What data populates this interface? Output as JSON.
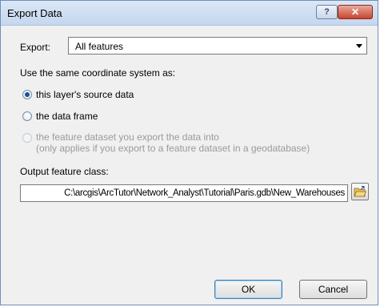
{
  "window": {
    "title": "Export Data"
  },
  "titlebar": {
    "help_label": "?",
    "close_label": "✕"
  },
  "export": {
    "label": "Export:",
    "selected": "All features"
  },
  "coordinate": {
    "label": "Use the same coordinate system as:",
    "options": [
      {
        "label": "this layer's source data",
        "checked": true,
        "enabled": true
      },
      {
        "label": "the data frame",
        "checked": false,
        "enabled": true
      },
      {
        "label": "the feature dataset you export the data into",
        "note": "(only applies if you export to a feature dataset in a geodatabase)",
        "checked": false,
        "enabled": false
      }
    ]
  },
  "output": {
    "label": "Output feature class:",
    "path": "C:\\arcgis\\ArcTutor\\Network_Analyst\\Tutorial\\Paris.gdb\\New_Warehouses",
    "browse_icon": "folder-open-icon"
  },
  "buttons": {
    "ok": "OK",
    "cancel": "Cancel"
  },
  "colors": {
    "accent": "#1f4f93",
    "close": "#c9452f",
    "disabled_text": "#9a9a9a"
  }
}
